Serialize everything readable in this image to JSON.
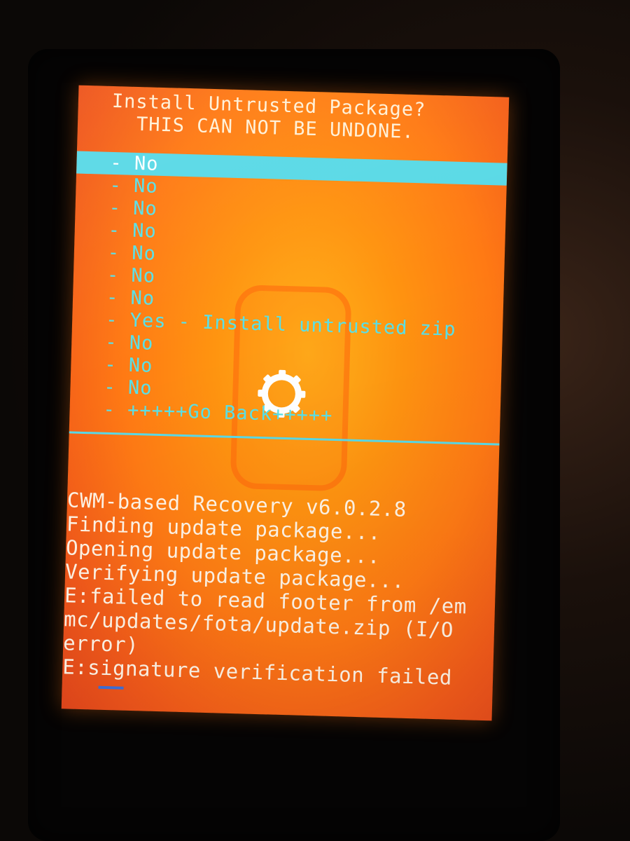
{
  "menu": {
    "header_line1": "Install Untrusted Package?",
    "header_line2": "THIS CAN NOT BE UNDONE.",
    "items": [
      {
        "label": "- No"
      },
      {
        "label": "- No"
      },
      {
        "label": "- No"
      },
      {
        "label": "- No"
      },
      {
        "label": "- No"
      },
      {
        "label": "- No"
      },
      {
        "label": "- No"
      },
      {
        "label": "- Yes - Install untrusted zip"
      },
      {
        "label": "- No"
      },
      {
        "label": "- No"
      },
      {
        "label": "- No"
      },
      {
        "label": "- +++++Go Back+++++"
      }
    ],
    "selected_index": 0
  },
  "log": {
    "lines": [
      "CWM-based Recovery v6.0.2.8",
      "Finding update package...",
      "Opening update package...",
      "Verifying update package...",
      "E:failed to read footer from /em",
      "mc/updates/fota/update.zip (I/O",
      "error)",
      "E:signature verification failed"
    ]
  },
  "icons": {
    "center_logo": "gear-icon"
  },
  "colors": {
    "menu_text": "#58e0e8",
    "highlight": "#5ad9e6",
    "log_text": "#fff4e6",
    "screen_bg": "#ff8c12"
  }
}
